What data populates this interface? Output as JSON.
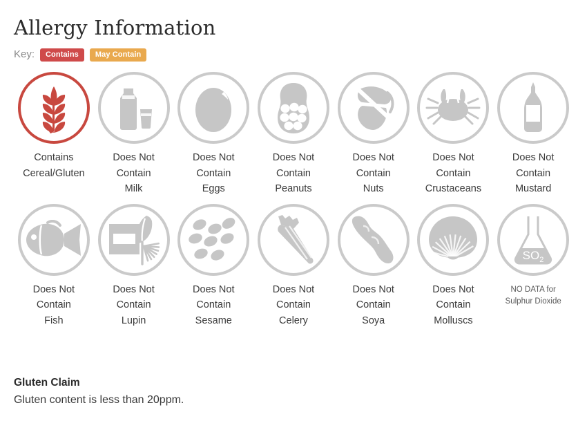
{
  "header": {
    "title": "Allergy Information",
    "key_label": "Key:",
    "badges": [
      {
        "text": "Contains",
        "color": "#cf4a4a",
        "name": "contains"
      },
      {
        "text": "May Contain",
        "color": "#e9a94e",
        "name": "may-contain"
      }
    ]
  },
  "colors": {
    "contains_red": "#c8483f",
    "neutral_grey": "#cacaca",
    "icon_grey": "#c6c6c6",
    "text_dark": "#3a3a3a",
    "text_muted": "#8b8b8b"
  },
  "allergens": {
    "row1": [
      {
        "icon": "cereal-gluten-icon",
        "status": "Contains",
        "line2": "Cereal/Gluten",
        "line3": "",
        "state": "contains"
      },
      {
        "icon": "milk-icon",
        "status": "Does Not",
        "line2": "Contain",
        "line3": "Milk",
        "state": "free"
      },
      {
        "icon": "eggs-icon",
        "status": "Does Not",
        "line2": "Contain",
        "line3": "Eggs",
        "state": "free"
      },
      {
        "icon": "peanuts-icon",
        "status": "Does Not",
        "line2": "Contain",
        "line3": "Peanuts",
        "state": "free"
      },
      {
        "icon": "nuts-icon",
        "status": "Does Not",
        "line2": "Contain",
        "line3": "Nuts",
        "state": "free"
      },
      {
        "icon": "crustaceans-icon",
        "status": "Does Not",
        "line2": "Contain",
        "line3": "Crustaceans",
        "state": "free"
      },
      {
        "icon": "mustard-icon",
        "status": "Does Not",
        "line2": "Contain",
        "line3": "Mustard",
        "state": "free"
      }
    ],
    "row2": [
      {
        "icon": "fish-icon",
        "status": "Does Not",
        "line2": "Contain",
        "line3": "Fish",
        "state": "free"
      },
      {
        "icon": "lupin-icon",
        "status": "Does Not",
        "line2": "Contain",
        "line3": "Lupin",
        "state": "free"
      },
      {
        "icon": "sesame-icon",
        "status": "Does Not",
        "line2": "Contain",
        "line3": "Sesame",
        "state": "free"
      },
      {
        "icon": "celery-icon",
        "status": "Does Not",
        "line2": "Contain",
        "line3": "Celery",
        "state": "free"
      },
      {
        "icon": "soya-icon",
        "status": "Does Not",
        "line2": "Contain",
        "line3": "Soya",
        "state": "free"
      },
      {
        "icon": "molluscs-icon",
        "status": "Does Not",
        "line2": "Contain",
        "line3": "Molluscs",
        "state": "free"
      },
      {
        "icon": "sulphur-dioxide-flask-icon",
        "status": "NO DATA for",
        "line2": "Sulphur Dioxide",
        "line3": "",
        "state": "nodata",
        "flask_label": "SO",
        "flask_sub": "2"
      }
    ]
  },
  "claim": {
    "title": "Gluten Claim",
    "body": "Gluten content is less than 20ppm."
  }
}
